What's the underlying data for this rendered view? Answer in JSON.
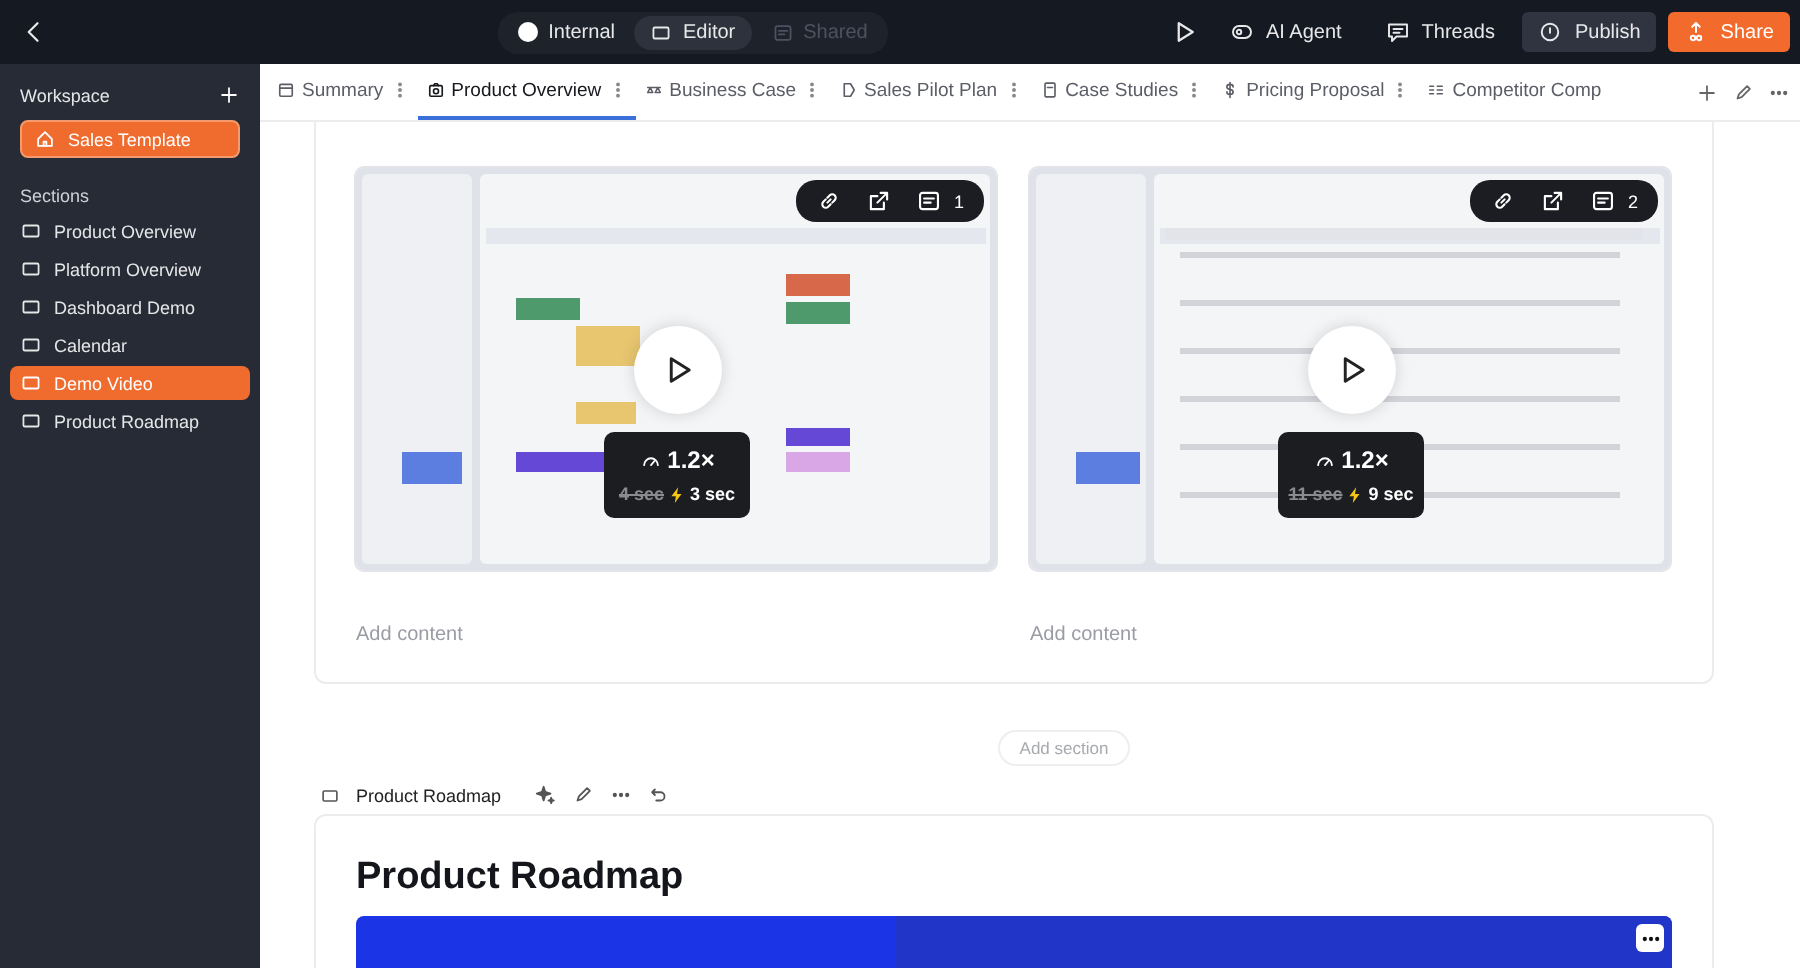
{
  "topbar": {
    "modes": [
      {
        "label": "Internal",
        "selected": false,
        "disabled": false
      },
      {
        "label": "Editor",
        "selected": true,
        "disabled": false
      },
      {
        "label": "Shared",
        "selected": false,
        "disabled": true
      }
    ],
    "actions": [
      {
        "label": "AI Agent",
        "kind": "plain"
      },
      {
        "label": "Threads",
        "kind": "plain"
      },
      {
        "label": "Publish",
        "kind": "secondary"
      },
      {
        "label": "Share",
        "kind": "primary"
      }
    ]
  },
  "sidebar": {
    "title": "Workspace",
    "workspace_item": {
      "label": "Sales Template",
      "selected": true
    },
    "sections_label": "Sections",
    "items": [
      {
        "label": "Product Overview",
        "selected": false
      },
      {
        "label": "Platform Overview",
        "selected": false
      },
      {
        "label": "Dashboard Demo",
        "selected": false
      },
      {
        "label": "Calendar",
        "selected": false
      },
      {
        "label": "Demo Video",
        "selected": true
      },
      {
        "label": "Product Roadmap",
        "selected": false
      }
    ]
  },
  "tabs": [
    {
      "label": "Summary",
      "selected": false
    },
    {
      "label": "Product Overview",
      "selected": true
    },
    {
      "label": "Business Case",
      "selected": false
    },
    {
      "label": "Sales Pilot Plan",
      "selected": false
    },
    {
      "label": "Case Studies",
      "selected": false
    },
    {
      "label": "Pricing Proposal",
      "selected": false
    },
    {
      "label": "Competitor Comp",
      "selected": false
    }
  ],
  "videos": [
    {
      "kind": "calendar",
      "comments": "1",
      "speed": "1.2×",
      "old_time": "4 sec",
      "new_time": "3 sec",
      "add_content": "Add content"
    },
    {
      "kind": "table",
      "comments": "2",
      "speed": "1.2×",
      "old_time": "11 sec",
      "new_time": "9 sec",
      "add_content": "Add content"
    }
  ],
  "add_section": "Add section",
  "next_section": {
    "label": "Product Roadmap",
    "heading": "Product Roadmap"
  }
}
